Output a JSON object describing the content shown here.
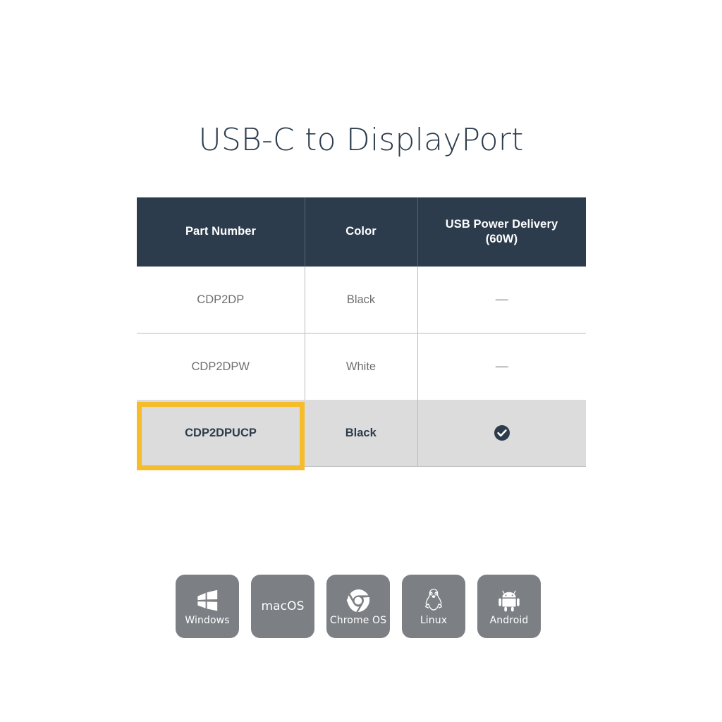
{
  "page": {
    "background": "#ffffff",
    "title": "USB-C to DisplayPort"
  },
  "colors": {
    "header_bg": "#2c3c4c",
    "highlight_row_bg": "#dcdcdc",
    "highlight_outline": "#f6bc2a",
    "body_text": "#6f6f6f",
    "tile_bg": "#7c8085",
    "grid_line": "#b9bcbf"
  },
  "table": {
    "columns": [
      {
        "label": "Part Number"
      },
      {
        "label": "Color"
      },
      {
        "label": "USB Power Delivery\n(60W)",
        "line1": "USB Power Delivery",
        "line2": "(60W)"
      }
    ],
    "rows": [
      {
        "part_number": "CDP2DP",
        "color": "Black",
        "usb_pd": "—",
        "usb_pd_type": "dash",
        "highlighted": false
      },
      {
        "part_number": "CDP2DPW",
        "color": "White",
        "usb_pd": "—",
        "usb_pd_type": "dash",
        "highlighted": false
      },
      {
        "part_number": "CDP2DPUCP",
        "color": "Black",
        "usb_pd": "✔",
        "usb_pd_type": "check",
        "highlighted": true
      }
    ]
  },
  "os_support": [
    {
      "label": "Windows",
      "icon": "windows-icon",
      "text_only": false
    },
    {
      "label": "macOS",
      "icon": "macos-wordmark",
      "text_only": true
    },
    {
      "label": "Chrome OS",
      "icon": "chrome-icon",
      "text_only": false
    },
    {
      "label": "Linux",
      "icon": "linux-penguin-icon",
      "text_only": false
    },
    {
      "label": "Android",
      "icon": "android-icon",
      "text_only": false
    }
  ]
}
